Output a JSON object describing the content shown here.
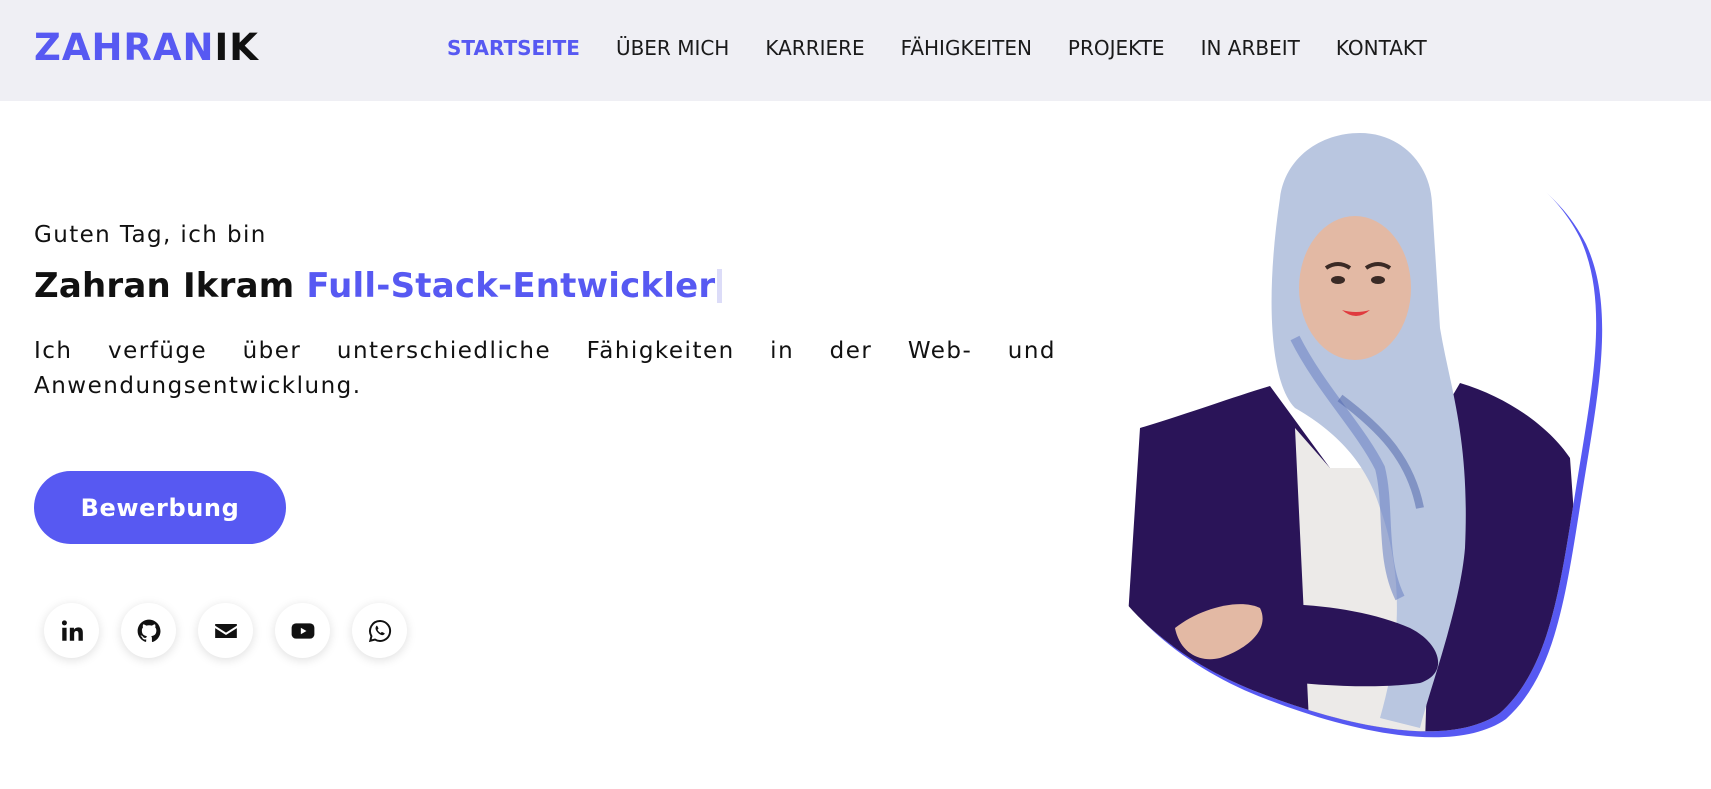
{
  "header": {
    "logo_part1": "ZAHRAN",
    "logo_part2": "IK",
    "nav": [
      {
        "label": "STARTSEITE"
      },
      {
        "label": "ÜBER MICH"
      },
      {
        "label": "KARRIERE"
      },
      {
        "label": "FÄHIGKEITEN"
      },
      {
        "label": "PROJEKTE"
      },
      {
        "label": "IN ARBEIT"
      },
      {
        "label": "KONTAKT"
      }
    ]
  },
  "hero": {
    "greeting": "Guten Tag, ich bin",
    "name": "Zahran Ikram",
    "role": "Full-Stack-Entwickler",
    "description": "Ich verfüge über unterschiedliche Fähigkeiten in der Web- und Anwendungsentwicklung.",
    "cta_label": "Bewerbung"
  },
  "socials": [
    {
      "icon": "linkedin-icon"
    },
    {
      "icon": "github-icon"
    },
    {
      "icon": "envelope-icon"
    },
    {
      "icon": "youtube-icon"
    },
    {
      "icon": "whatsapp-icon"
    }
  ],
  "colors": {
    "accent": "#5759f2",
    "header_bg": "#efeff4",
    "text": "#111111",
    "jacket": "#2a1458"
  }
}
